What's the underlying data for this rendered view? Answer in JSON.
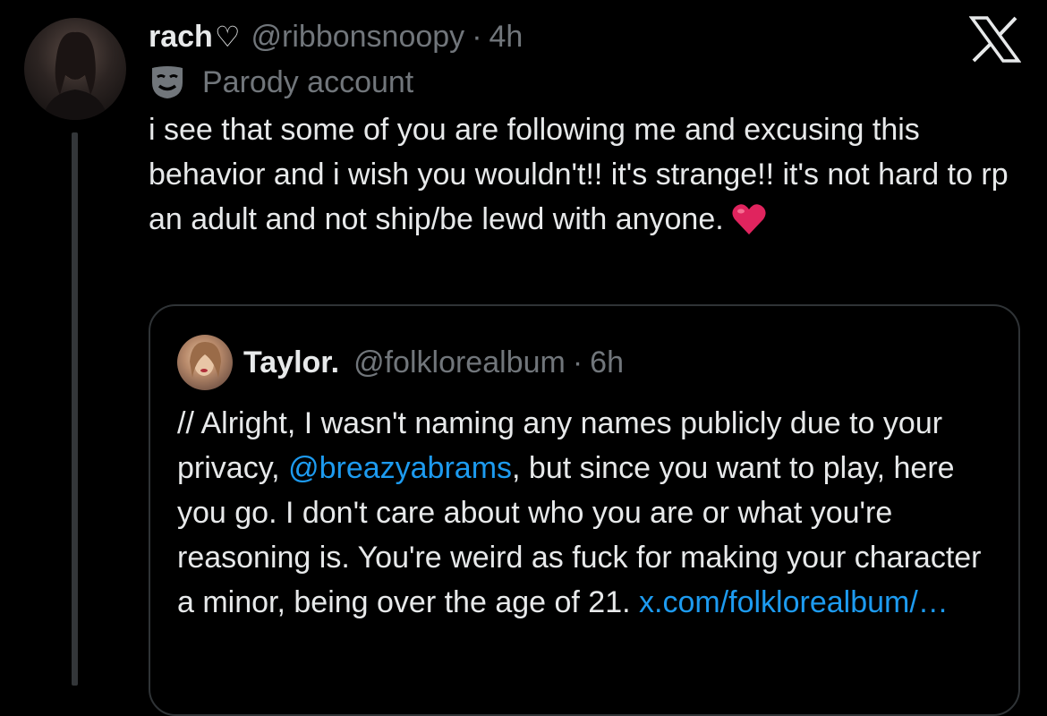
{
  "tweet": {
    "display_name": "rach",
    "name_suffix": "♡",
    "handle": "@ribbonsnoopy",
    "separator": "·",
    "time": "4h",
    "account_label": "Parody account",
    "text": "i see that some of you are following me and excusing this behavior and i wish you wouldn't!! it's strange!! it's not hard to rp an adult and not ship/be lewd with anyone.",
    "emoji": "heart-emoji"
  },
  "quoted": {
    "display_name": "Taylor.",
    "handle": "@folklorealbum",
    "separator": "·",
    "time": "6h",
    "text_part1": "// Alright, I wasn't naming any names publicly due to your privacy, ",
    "mention": "@breazyabrams",
    "text_part2": ", but since you want to play, here you go. I don't care about who you are or what you're reasoning is. You're weird as fuck for making your character a minor, being over the age of 21. ",
    "link": "x.com/folklorealbum/…"
  },
  "colors": {
    "background": "#000000",
    "text": "#e7e9ea",
    "secondary": "#71767b",
    "link": "#1d9bf0",
    "border": "#2f3336",
    "emoji_heart": "#e0245e"
  },
  "icons": [
    "x-logo-icon",
    "parody-mask-icon",
    "heart-emoji"
  ]
}
